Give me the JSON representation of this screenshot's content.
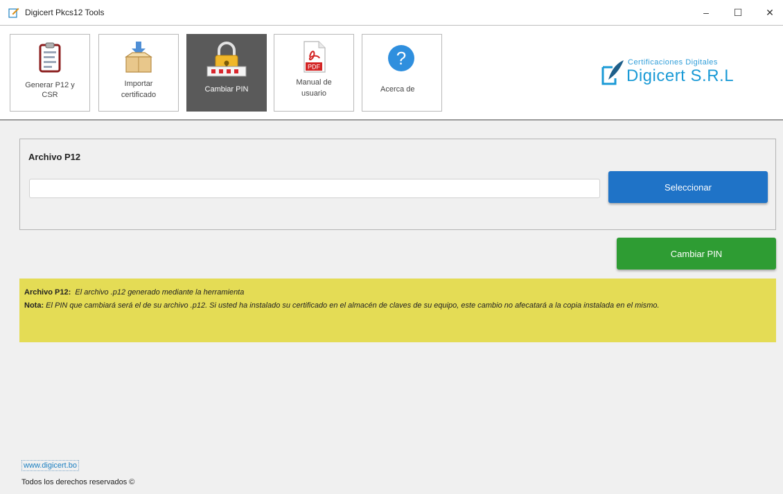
{
  "window": {
    "title": "Digicert Pkcs12 Tools",
    "min_glyph": "–",
    "max_glyph": "☐",
    "close_glyph": "✕"
  },
  "toolbar": {
    "buttons": [
      {
        "label_line1": "Generar P12 y",
        "label_line2": "CSR",
        "icon": "clipboard-icon"
      },
      {
        "label_line1": "Importar",
        "label_line2": "certificado",
        "icon": "box-import-icon"
      },
      {
        "label_line1": "Cambiar PIN",
        "label_line2": "",
        "icon": "lock-pin-icon"
      },
      {
        "label_line1": "Manual de",
        "label_line2": "usuario",
        "icon": "pdf-icon",
        "badge": "PDF"
      },
      {
        "label_line1": "Acerca de",
        "label_line2": "",
        "icon": "help-icon",
        "glyph": "?"
      }
    ],
    "active_index": 2
  },
  "logo": {
    "tagline": "Certificaciones Digitales",
    "name": "Digicert S.R.L"
  },
  "form": {
    "section_title": "Archivo P12",
    "file_value": "",
    "select_label": "Seleccionar",
    "submit_label": "Cambiar PIN"
  },
  "info": {
    "archivo_label": "Archivo P12:",
    "archivo_text": "El archivo .p12 generado mediante la herramienta",
    "nota_label": "Nota:",
    "nota_text": "El PIN que cambiará será el de su archivo .p12. Si usted ha instalado su certificado en el almacén de claves de su equipo, este cambio no afecatará a la copia instalada en el mismo."
  },
  "footer": {
    "link": "www.digicert.bo",
    "copyright": "Todos los derechos reservados ©"
  },
  "colors": {
    "select_button": "#1f73c7",
    "pin_button": "#2e9c33",
    "info_background": "#e4dc55",
    "active_tab": "#5a5a5a",
    "brand": "#1a9ad6"
  }
}
